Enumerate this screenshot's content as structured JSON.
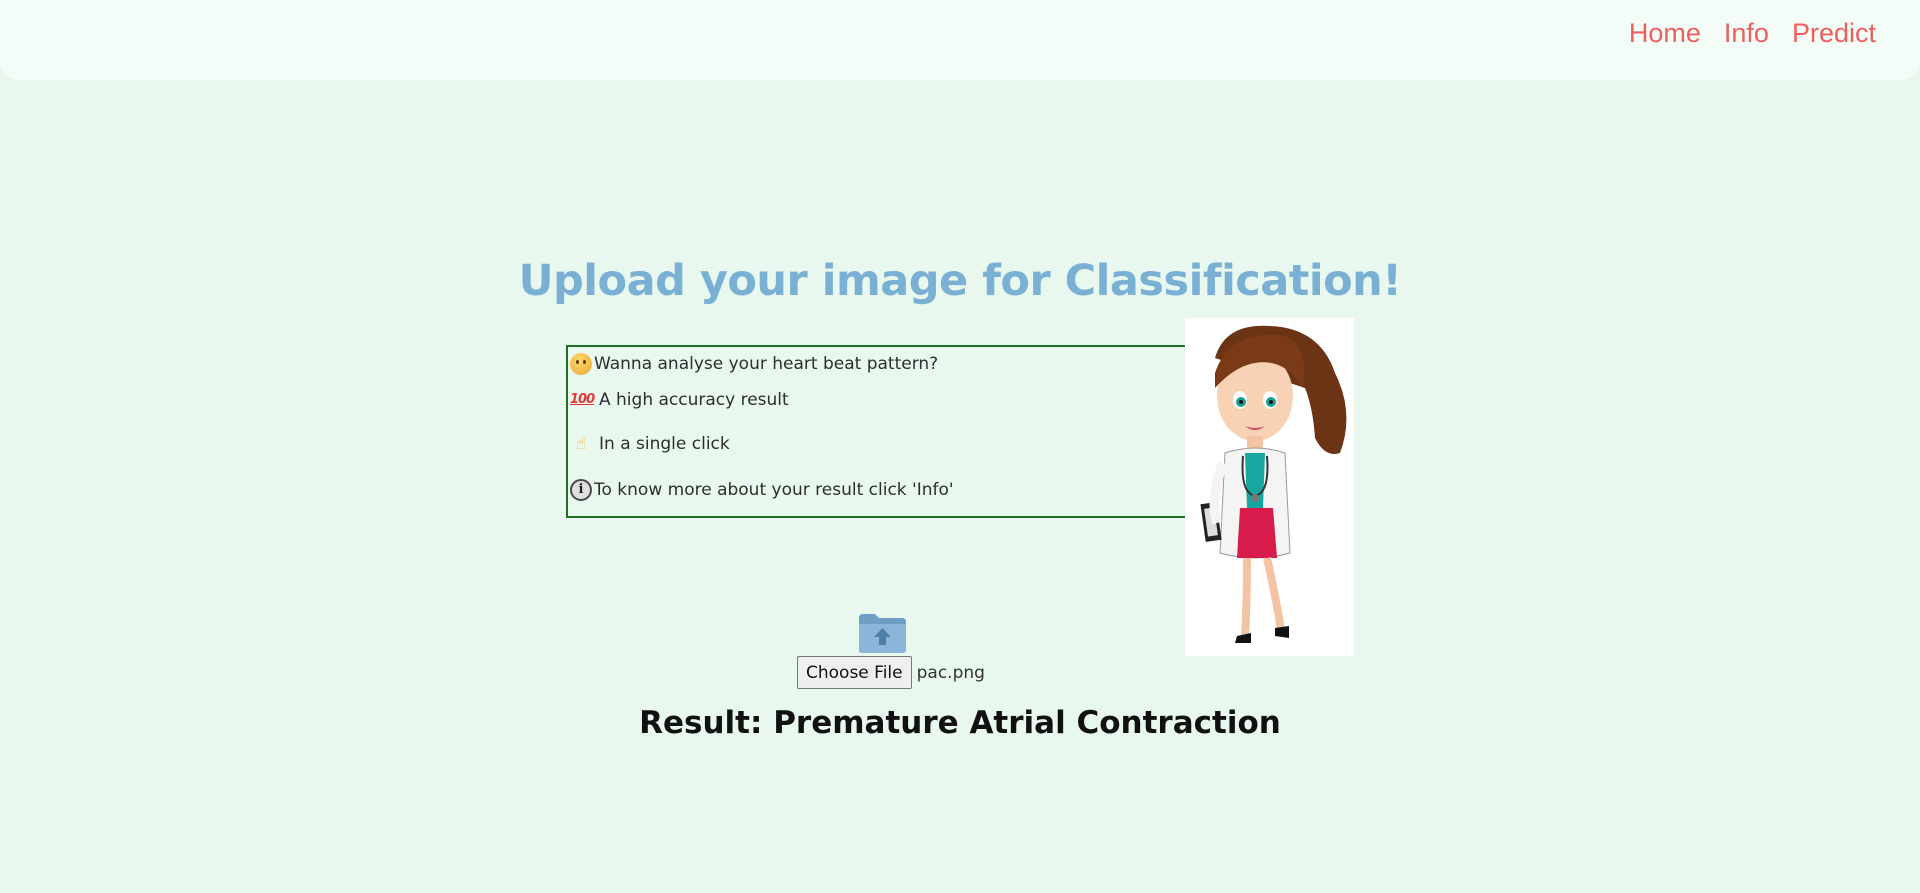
{
  "nav": {
    "links": [
      "Home",
      "Info",
      "Predict"
    ]
  },
  "header": {
    "title": "Upload your image for Classification!"
  },
  "features": [
    {
      "icon": "thinking-face-icon",
      "text": "Wanna analyse your heart beat pattern?"
    },
    {
      "icon": "hundred-points-icon",
      "text": "A high accuracy result"
    },
    {
      "icon": "pointing-up-icon",
      "text": "In a single click"
    },
    {
      "icon": "info-icon",
      "text": "To know more about your result click 'Info'"
    }
  ],
  "upload": {
    "button_label": "Choose File",
    "file_name": "pac.png"
  },
  "result": {
    "text": "Result: Premature Atrial Contraction"
  },
  "colors": {
    "background": "#e8f8ee",
    "navbar": "#f3fcf7",
    "nav_link": "#ee5f5f",
    "title": "#7ab0d4",
    "box_border": "#1f6f1f"
  }
}
